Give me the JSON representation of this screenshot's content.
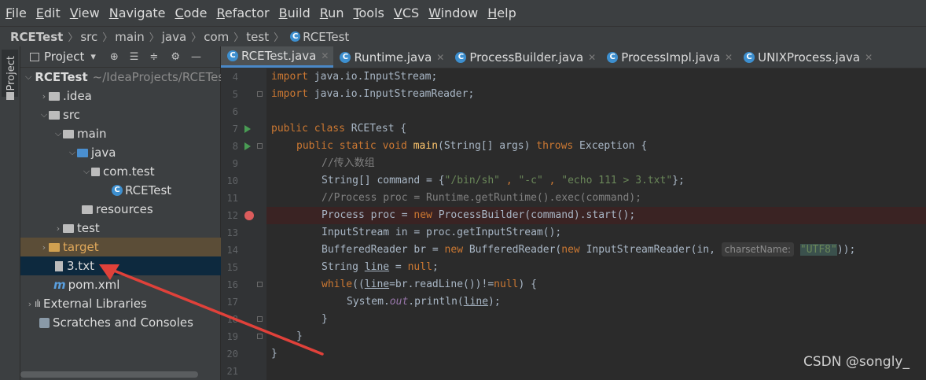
{
  "menu": [
    "File",
    "Edit",
    "View",
    "Navigate",
    "Code",
    "Refactor",
    "Build",
    "Run",
    "Tools",
    "VCS",
    "Window",
    "Help"
  ],
  "breadcrumb": [
    "RCETest",
    "src",
    "main",
    "java",
    "com",
    "test",
    "RCETest"
  ],
  "project_panel": {
    "title": "Project",
    "dropdown": "▾",
    "tools": [
      "⊕",
      "☰",
      "≑",
      "⚙",
      "—"
    ],
    "tree": [
      {
        "name": "RCETest",
        "suffix": "~/IdeaProjects/RCETest",
        "arrow": "v",
        "icon": "project-folder"
      },
      {
        "name": ".idea",
        "arrow": ">",
        "icon": "folder"
      },
      {
        "name": "src",
        "arrow": "v",
        "icon": "folder"
      },
      {
        "name": "main",
        "arrow": "v",
        "icon": "folder"
      },
      {
        "name": "java",
        "arrow": "v",
        "icon": "source-folder"
      },
      {
        "name": "com.test",
        "arrow": "v",
        "icon": "package"
      },
      {
        "name": "RCETest",
        "arrow": "",
        "icon": "class"
      },
      {
        "name": "resources",
        "arrow": "",
        "icon": "resources-folder"
      },
      {
        "name": "test",
        "arrow": ">",
        "icon": "folder"
      },
      {
        "name": "target",
        "arrow": ">",
        "icon": "excluded-folder"
      },
      {
        "name": "3.txt",
        "arrow": "",
        "icon": "text-file"
      },
      {
        "name": "pom.xml",
        "arrow": "",
        "icon": "maven"
      },
      {
        "name": "External Libraries",
        "arrow": ">",
        "icon": "library"
      },
      {
        "name": "Scratches and Consoles",
        "arrow": "",
        "icon": "scratch"
      }
    ]
  },
  "stripe": {
    "project_label": "Project"
  },
  "tabs": [
    {
      "label": "RCETest.java",
      "active": true
    },
    {
      "label": "Runtime.java",
      "active": false
    },
    {
      "label": "ProcessBuilder.java",
      "active": false
    },
    {
      "label": "ProcessImpl.java",
      "active": false
    },
    {
      "label": "UNIXProcess.java",
      "active": false
    }
  ],
  "editor": {
    "line_numbers": [
      "4",
      "5",
      "6",
      "7",
      "8",
      "9",
      "10",
      "11",
      "12",
      "13",
      "14",
      "15",
      "16",
      "17",
      "18",
      "19",
      "20",
      "21"
    ],
    "lines": {
      "l4": {
        "kw": "import",
        "rest": " java.io.InputStream;"
      },
      "l5": {
        "kw": "import",
        "rest": " java.io.InputStreamReader;"
      },
      "l7": {
        "kw": "public class",
        "rest": " RCETest {"
      },
      "l8": {
        "kw": "public static void",
        "fn": "main",
        "rest1": "(String[] args) ",
        "kw2": "throws",
        "rest2": " Exception {"
      },
      "l9": {
        "comment": "//传入数组"
      },
      "l10": {
        "a": "String[] command = {",
        "s1": "\"/bin/sh\"",
        "b": " , ",
        "s2": "\"-c\"",
        "c": " , ",
        "s3": "\"echo 111 > 3.txt\"",
        "d": "};"
      },
      "l11": {
        "comment": "//Process proc = Runtime.getRuntime().exec(command);"
      },
      "l12": {
        "a": "Process proc = ",
        "kw": "new",
        "b": " ProcessBuilder(command).start();"
      },
      "l13": {
        "a": "InputStream in = proc.getInputStream();"
      },
      "l14": {
        "a": "BufferedReader br = ",
        "kw": "new",
        "b": " BufferedReader(",
        "kw2": "new",
        "c": " InputStreamReader(in, ",
        "hint": "charsetName:",
        "s": "\"UTF8\"",
        "d": "));"
      },
      "l15": {
        "a": "String ",
        "u": "line",
        "b": " = ",
        "kw": "null",
        "c": ";"
      },
      "l16": {
        "kw": "while",
        "a": "((",
        "u": "line",
        "b": "=br.readLine())!=",
        "kw2": "null",
        "c": ") {"
      },
      "l17": {
        "a": "System.",
        "f": "out",
        "b": ".println(",
        "u": "line",
        "c": ");"
      },
      "l18": {
        "a": "}"
      },
      "l19": {
        "a": "}"
      },
      "l20": {
        "a": "}"
      }
    }
  },
  "watermark": "CSDN @songly_",
  "colors": {
    "accent": "#4a88c7",
    "keyword": "#cc7832",
    "string": "#6a8759",
    "arrow": "#e0413a"
  }
}
